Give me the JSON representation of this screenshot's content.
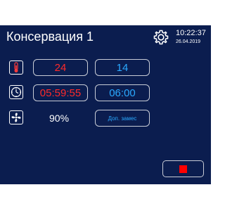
{
  "header": {
    "title": "Консервация 1",
    "time": "10:22:37",
    "date": "26.04.2019"
  },
  "rows": {
    "temperature": {
      "icon": "thermometer-icon",
      "current": "24",
      "setpoint": "14"
    },
    "timer": {
      "icon": "clock-icon",
      "current": "05:59:55",
      "setpoint": "06:00"
    },
    "fan": {
      "icon": "fan-icon",
      "value": "90%",
      "button_label": "Доп. замес"
    }
  },
  "stop_button": {
    "icon": "stop-icon"
  },
  "colors": {
    "background": "#0b1d4f",
    "current_value": "#ff2a2a",
    "setpoint_value": "#2aa9ff",
    "stop": "#ff0000"
  }
}
